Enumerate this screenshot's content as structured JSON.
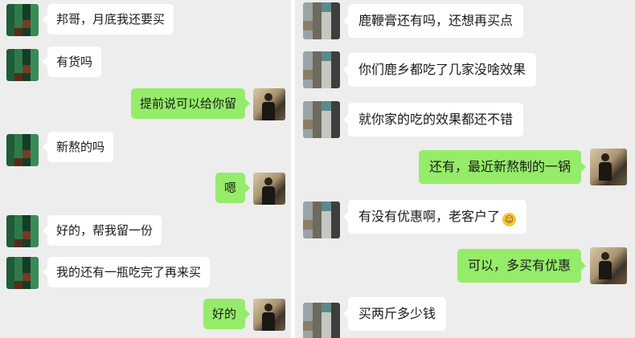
{
  "left_chat": {
    "messages": [
      {
        "side": "in",
        "text": "邦哥，月底我还要买",
        "avatar": "green-mosaic-avatar"
      },
      {
        "side": "in",
        "text": "有货吗",
        "avatar": "green-mosaic-avatar"
      },
      {
        "side": "out",
        "text": "提前说可以给你留",
        "avatar": "photo-avatar"
      },
      {
        "side": "in",
        "text": "新熬的吗",
        "avatar": "green-mosaic-avatar"
      },
      {
        "side": "out",
        "text": "嗯",
        "avatar": "photo-avatar"
      },
      {
        "side": "in",
        "text": "好的，帮我留一份",
        "avatar": "green-mosaic-avatar"
      },
      {
        "side": "in",
        "text": "我的还有一瓶吃完了再来买",
        "avatar": "green-mosaic-avatar"
      },
      {
        "side": "out",
        "text": "好的",
        "avatar": "photo-avatar"
      }
    ]
  },
  "right_chat": {
    "messages": [
      {
        "side": "in",
        "text": "鹿鞭膏还有吗，还想再买点",
        "avatar": "grey-mosaic-avatar"
      },
      {
        "side": "in",
        "text": "你们鹿乡都吃了几家没啥效果",
        "avatar": "grey-mosaic-avatar"
      },
      {
        "side": "in",
        "text": "就你家的吃的效果都还不错",
        "avatar": "grey-mosaic-avatar"
      },
      {
        "side": "out",
        "text": "还有，最近新熬制的一锅",
        "avatar": "photo-avatar"
      },
      {
        "side": "in",
        "text": "有没有优惠啊，老客户了",
        "emoji": "smile-emoji",
        "avatar": "grey-mosaic-avatar"
      },
      {
        "side": "out",
        "text": "可以，多买有优惠",
        "avatar": "photo-avatar"
      },
      {
        "side": "in",
        "text": "买两斤多少钱",
        "avatar": "grey-mosaic-avatar"
      }
    ]
  },
  "colors": {
    "chat_background": "#ededed",
    "incoming_bubble": "#ffffff",
    "outgoing_bubble": "#95ec69",
    "text": "#1a1a1a"
  }
}
